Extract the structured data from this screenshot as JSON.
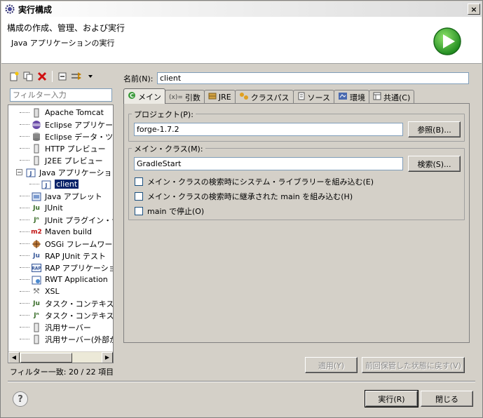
{
  "window": {
    "title": "実行構成",
    "close_glyph": "×"
  },
  "header": {
    "title": "構成の作成、管理、および実行",
    "description": "Java アプリケーションの実行"
  },
  "left": {
    "filter_placeholder": "フィルター入力",
    "tree": [
      {
        "label": "Apache Tomcat",
        "icon": "tomcat-icon",
        "level": 1
      },
      {
        "label": "Eclipse アプリケーショ",
        "icon": "eclipse-icon",
        "level": 1
      },
      {
        "label": "Eclipse データ・ツール",
        "icon": "database-icon",
        "level": 1
      },
      {
        "label": "HTTP プレビュー",
        "icon": "page-icon",
        "level": 1
      },
      {
        "label": "J2EE プレビュー",
        "icon": "page-icon",
        "level": 1
      },
      {
        "label": "Java アプリケーション",
        "icon": "java-app-icon",
        "level": 1,
        "expanded": true
      },
      {
        "label": "client",
        "icon": "java-app-icon",
        "level": 2,
        "selected": true
      },
      {
        "label": "Java アプレット",
        "icon": "applet-icon",
        "level": 1
      },
      {
        "label": "JUnit",
        "icon": "junit-icon",
        "level": 1
      },
      {
        "label": "JUnit プラグイン・テス",
        "icon": "junit-plugin-icon",
        "level": 1
      },
      {
        "label": "Maven build",
        "icon": "maven-icon",
        "level": 1
      },
      {
        "label": "OSGi フレームワーク",
        "icon": "osgi-icon",
        "level": 1
      },
      {
        "label": "RAP JUnit テスト",
        "icon": "rap-junit-icon",
        "level": 1
      },
      {
        "label": "RAP アプリケーション",
        "icon": "rap-icon",
        "level": 1
      },
      {
        "label": "RWT Application",
        "icon": "rwt-icon",
        "level": 1
      },
      {
        "label": "XSL",
        "icon": "xsl-icon",
        "level": 1
      },
      {
        "label": "タスク・コンテキスト・テ",
        "icon": "junit-icon",
        "level": 1
      },
      {
        "label": "タスク・コンテキスト・プ",
        "icon": "junit-plugin-icon",
        "level": 1
      },
      {
        "label": "汎用サーバー",
        "icon": "page-icon",
        "level": 1
      },
      {
        "label": "汎用サーバー(外部か",
        "icon": "page-icon",
        "level": 1
      }
    ],
    "filter_status": "フィルター一致: 20 / 22 項目"
  },
  "right": {
    "name_label": "名前(N):",
    "name_value": "client",
    "tabs": [
      {
        "label": "メイン",
        "icon": "main-tab-icon",
        "active": true
      },
      {
        "label": "引数",
        "icon": "args-tab-icon"
      },
      {
        "label": "JRE",
        "icon": "jre-tab-icon"
      },
      {
        "label": "クラスパス",
        "icon": "classpath-tab-icon"
      },
      {
        "label": "ソース",
        "icon": "source-tab-icon"
      },
      {
        "label": "環境",
        "icon": "env-tab-icon"
      },
      {
        "label": "共通(C)",
        "icon": "common-tab-icon"
      }
    ],
    "project_group": "プロジェクト(P):",
    "project_value": "forge-1.7.2",
    "browse_label": "参照(B)...",
    "main_class_group": "メイン・クラス(M):",
    "main_class_value": "GradleStart",
    "search_label": "検索(S)...",
    "checkbox_1": "メイン・クラスの検索時にシステム・ライブラリーを組み込む(E)",
    "checkbox_2": "メイン・クラスの検索時に継承された main を組み込む(H)",
    "checkbox_3": "main で停止(O)",
    "apply_label": "適用(Y)",
    "revert_label": "前回保管した状態に戻す(V)"
  },
  "footer": {
    "help_glyph": "?",
    "run_label": "実行(R)",
    "close_label": "閉じる"
  }
}
